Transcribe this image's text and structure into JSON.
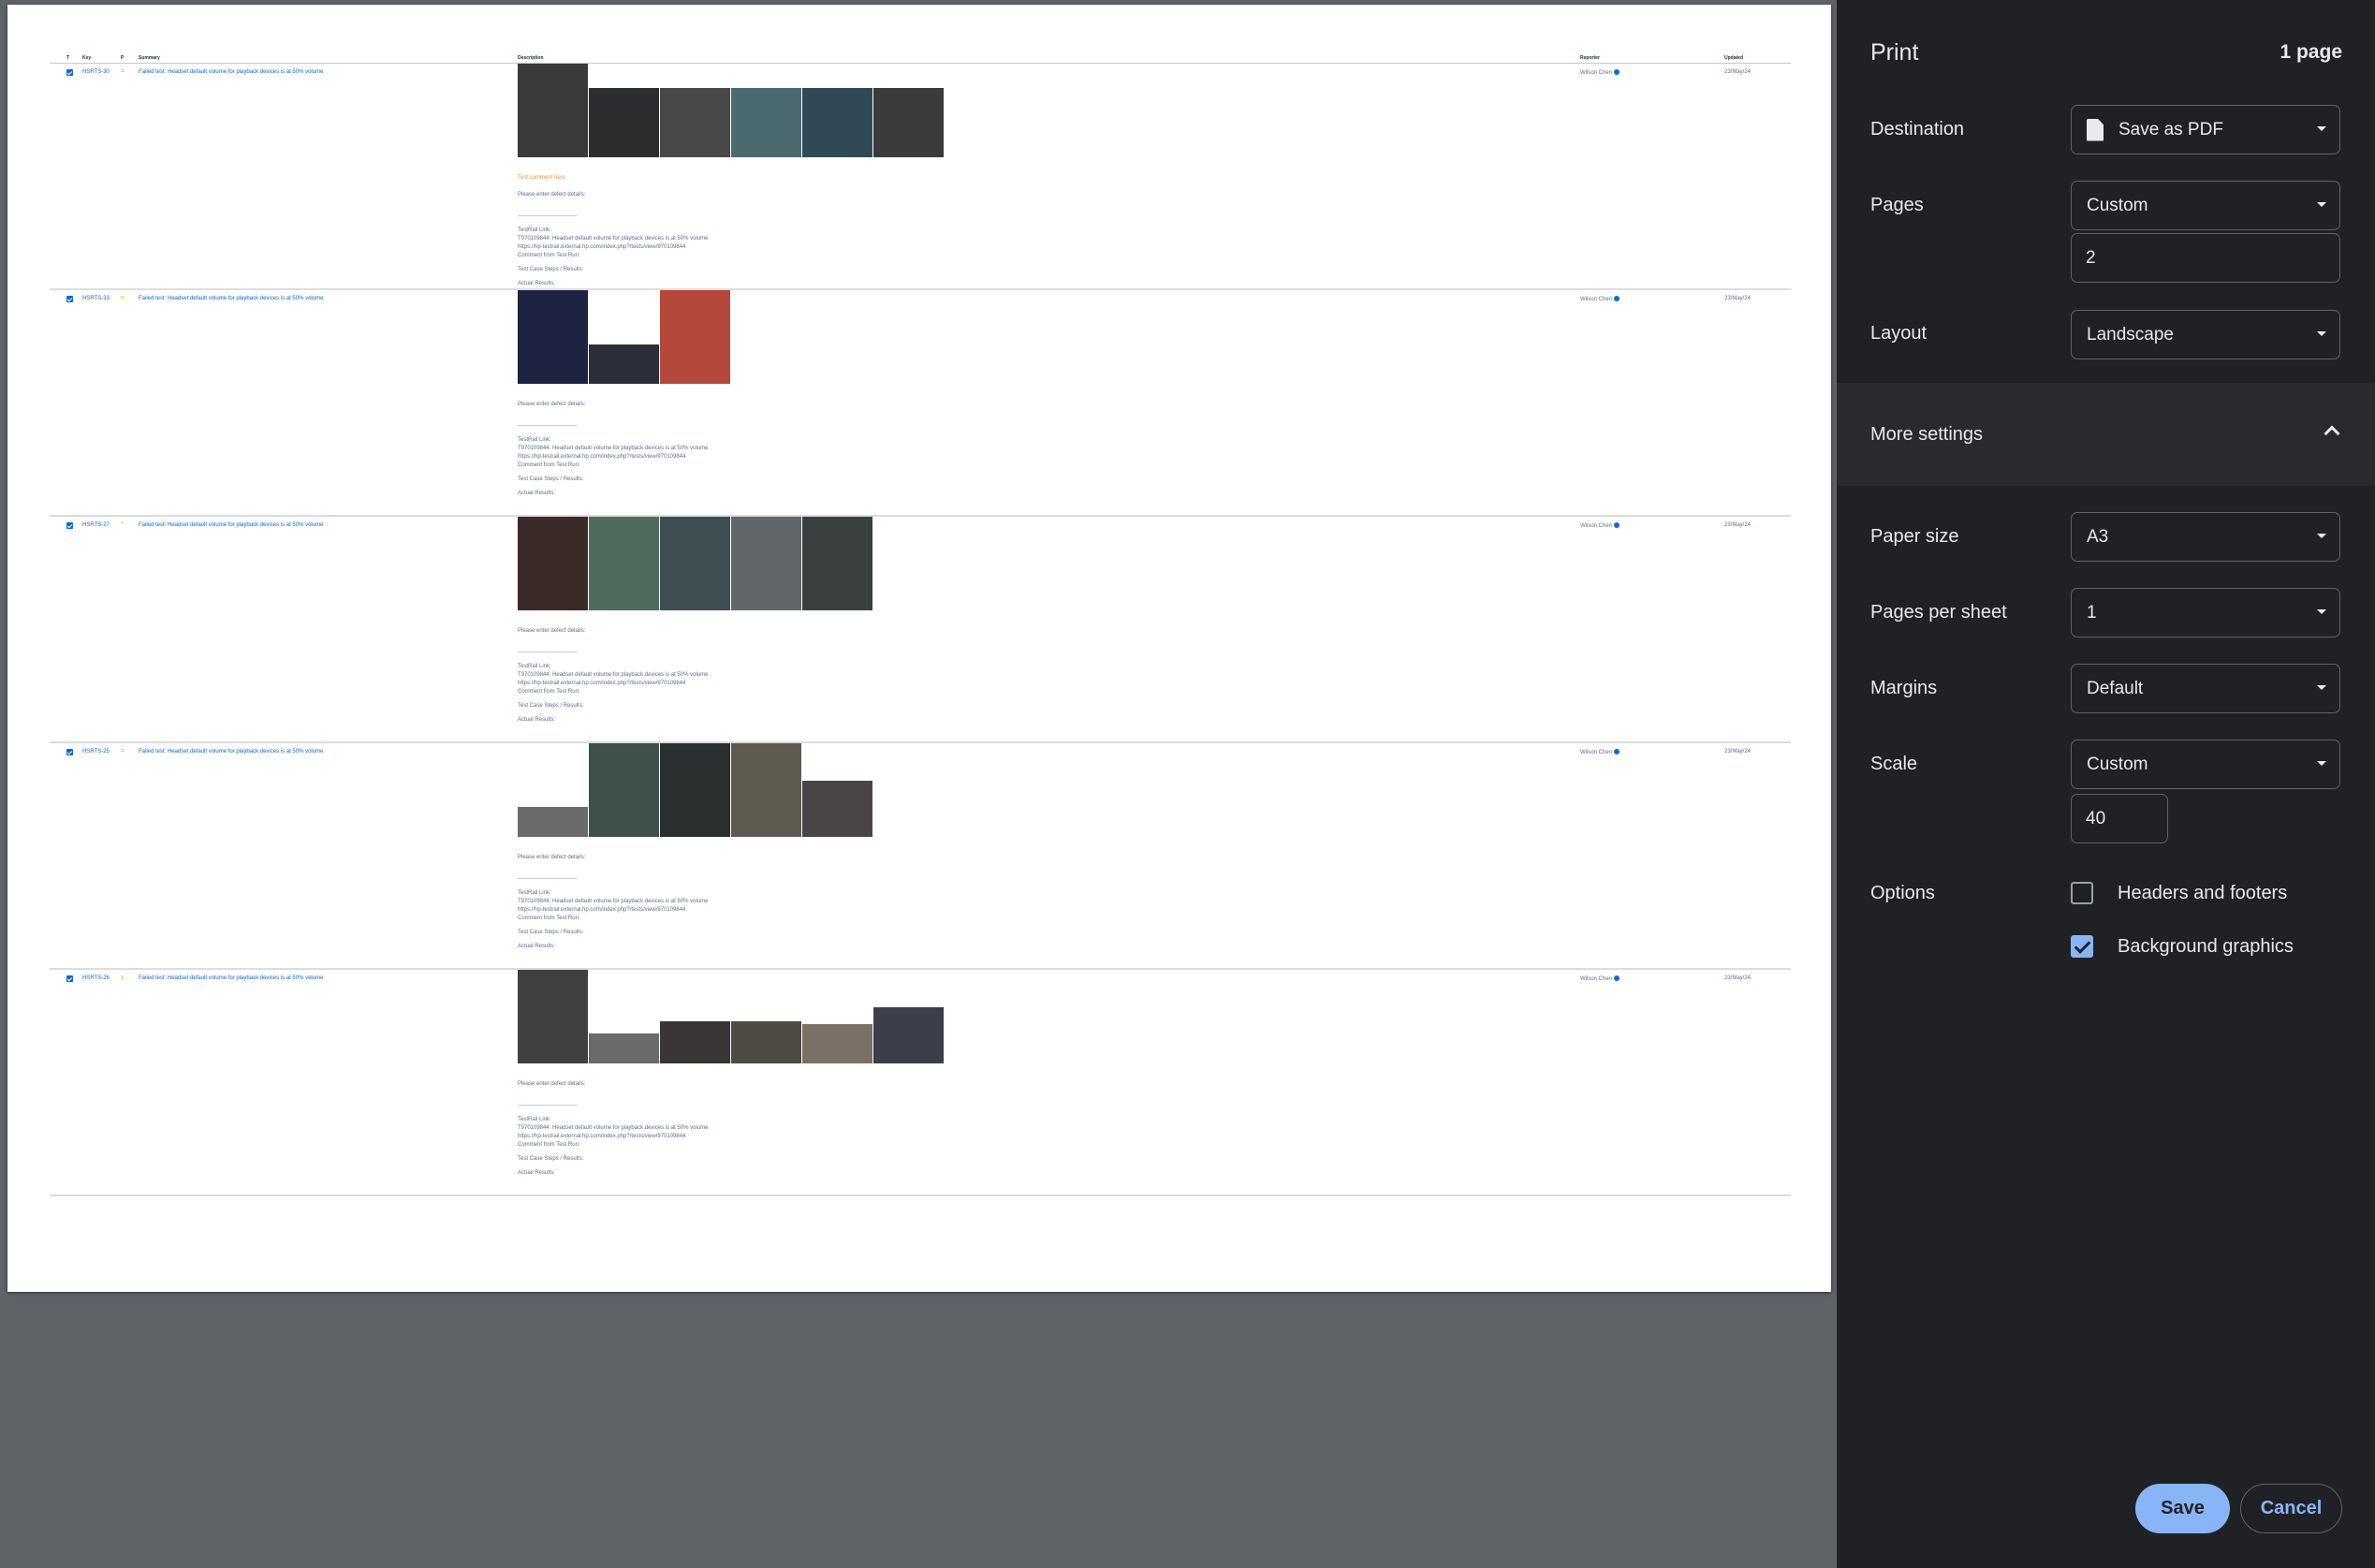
{
  "preview": {
    "columns": {
      "t": "T",
      "key": "Key",
      "p": "P",
      "summary": "Summary",
      "description": "Description",
      "reporter": "Reporter",
      "updated": "Updated"
    },
    "rows": [
      {
        "key": "HSRTS-30",
        "priority": "=",
        "summary": "Failed test: Headset default volume for playback devices is at 50% volume",
        "comment": "Test comment here",
        "desc": {
          "line1": "Please enter defect details:",
          "sep": "------------------------------------------------------",
          "testrail": "TestRail Link:",
          "link_text": "T970109844: Headset default volume for playback devices is at 50% volume",
          "link_url": "https://hp-testrail.external.hp.com/index.php?/tests/view/970109844",
          "comment_from": "Comment from Test Run:",
          "steps": "Test Case Steps / Results:",
          "actual": "Actual Results:"
        },
        "reporter": "Wilson Chen",
        "updated": "23/May/24"
      },
      {
        "key": "HSRTS-33",
        "priority": "=",
        "summary": "Failed test: Headset default volume for playback devices is at 50% volume",
        "comment": "",
        "desc": {
          "line1": "Please enter defect details:",
          "sep": "------------------------------------------------------",
          "testrail": "TestRail Link:",
          "link_text": "T970109844: Headset default volume for playback devices is at 50% volume",
          "link_url": "https://hp-testrail.external.hp.com/index.php?/tests/view/970109844",
          "comment_from": "Comment from Test Run:",
          "steps": "Test Case Steps / Results:",
          "actual": "Actual Results:"
        },
        "reporter": "Wilson Chen",
        "updated": "23/May/24"
      },
      {
        "key": "HSRTS-27",
        "priority": "^",
        "summary": "Failed test: Headset default volume for playback devices is at 50% volume",
        "comment": "",
        "desc": {
          "line1": "Please enter defect details:",
          "sep": "------------------------------------------------------",
          "testrail": "TestRail Link:",
          "link_text": "T970109844: Headset default volume for playback devices is at 50% volume",
          "link_url": "https://hp-testrail.external.hp.com/index.php?/tests/view/970109844",
          "comment_from": "Comment from Test Run:",
          "steps": "Test Case Steps / Results:",
          "actual": "Actual Results:"
        },
        "reporter": "Wilson Chen",
        "updated": "23/May/24"
      },
      {
        "key": "HSRTS-25",
        "priority": "=",
        "summary": "Failed test: Headset default volume for playback devices is at 50% volume",
        "comment": "",
        "desc": {
          "line1": "Please enter defect details:",
          "sep": "------------------------------------------------------",
          "testrail": "TestRail Link:",
          "link_text": "T970109844: Headset default volume for playback devices is at 50% volume",
          "link_url": "https://hp-testrail.external.hp.com/index.php?/tests/view/970109844",
          "comment_from": "Comment from Test Run:",
          "steps": "Test Case Steps / Results:",
          "actual": "Actual Results:"
        },
        "reporter": "Wilson Chen",
        "updated": "23/May/24"
      },
      {
        "key": "HSRTS-26",
        "priority": "v",
        "summary": "Failed test: Headset default volume for playback devices is at 50% volume",
        "comment": "",
        "desc": {
          "line1": "Please enter defect details:",
          "sep": "------------------------------------------------------",
          "testrail": "TestRail Link:",
          "link_text": "T970109844: Headset default volume for playback devices is at 50% volume",
          "link_url": "https://hp-testrail.external.hp.com/index.php?/tests/view/970109844",
          "comment_from": "Comment from Test Run:",
          "steps": "Test Case Steps / Results:",
          "actual": "Actual Results:"
        },
        "reporter": "Wilson Chen",
        "updated": "23/May/24"
      }
    ]
  },
  "panel": {
    "title": "Print",
    "page_count": "1 page",
    "destination": {
      "label": "Destination",
      "value": "Save as PDF"
    },
    "pages": {
      "label": "Pages",
      "value": "Custom",
      "custom_value": "2"
    },
    "layout": {
      "label": "Layout",
      "value": "Landscape"
    },
    "more_settings": "More settings",
    "paper_size": {
      "label": "Paper size",
      "value": "A3"
    },
    "pages_per_sheet": {
      "label": "Pages per sheet",
      "value": "1"
    },
    "margins": {
      "label": "Margins",
      "value": "Default"
    },
    "scale": {
      "label": "Scale",
      "value": "Custom",
      "custom_value": "40"
    },
    "options": {
      "label": "Options",
      "headers_footers": "Headers and footers",
      "headers_footers_checked": false,
      "background_graphics": "Background graphics",
      "background_graphics_checked": true
    },
    "save": "Save",
    "cancel": "Cancel"
  },
  "colors": {
    "panel_bg": "#202124",
    "accent": "#8ab4f8",
    "link_blue": "#0c66e4",
    "preview_bg": "#5f6368"
  }
}
